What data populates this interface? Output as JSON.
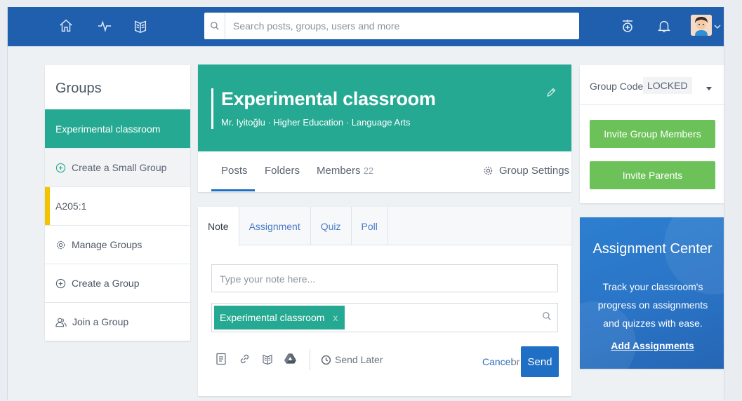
{
  "topbar": {
    "search_placeholder": "Search posts, groups, users and more",
    "icons": [
      "home-icon",
      "activity-icon",
      "backpack-icon",
      "megaphone-icon",
      "bell-icon",
      "avatar"
    ]
  },
  "sidebar": {
    "title": "Groups",
    "items": [
      {
        "label": "Experimental classroom",
        "icon": null,
        "state": "active"
      },
      {
        "label": "Create a Small Group",
        "icon": "plus-circle-icon",
        "state": "muted"
      },
      {
        "label": "A205:1",
        "icon": null,
        "state": "flagged"
      },
      {
        "label": "Manage Groups",
        "icon": "gear-icon"
      },
      {
        "label": "Create a Group",
        "icon": "plus-circle-icon"
      },
      {
        "label": "Join a Group",
        "icon": "users-icon"
      }
    ]
  },
  "group": {
    "title": "Experimental classroom",
    "subtitle": "Mr. Iyitoğlu · Higher Education · Language Arts",
    "tabs": [
      {
        "label": "Posts",
        "count": null
      },
      {
        "label": "Folders",
        "count": null
      },
      {
        "label": "Members",
        "count": "22"
      }
    ],
    "settings_label": "Group Settings"
  },
  "composer": {
    "tabs": [
      "Note",
      "Assignment",
      "Quiz",
      "Poll"
    ],
    "active_tab": "Note",
    "note_placeholder": "Type your note here...",
    "recipient_chip": "Experimental classroom",
    "chip_remove": "x",
    "send_later": "Send Later",
    "cancel": "Cancel",
    "or": "or",
    "send": "Send"
  },
  "group_panel": {
    "code_label": "Group Code:",
    "code_value": "LOCKED",
    "invite_members": "Invite Group Members",
    "invite_parents": "Invite Parents"
  },
  "promo": {
    "title": "Assignment Center",
    "body": "Track your classroom's progress on assignments and quizzes with ease.",
    "link": "Add Assignments"
  },
  "colors": {
    "topbar": "#1f5fae",
    "accent_teal": "#26a992",
    "button_green": "#6cc259",
    "send_blue": "#1f6fc5",
    "flag_yellow": "#f2c300"
  }
}
